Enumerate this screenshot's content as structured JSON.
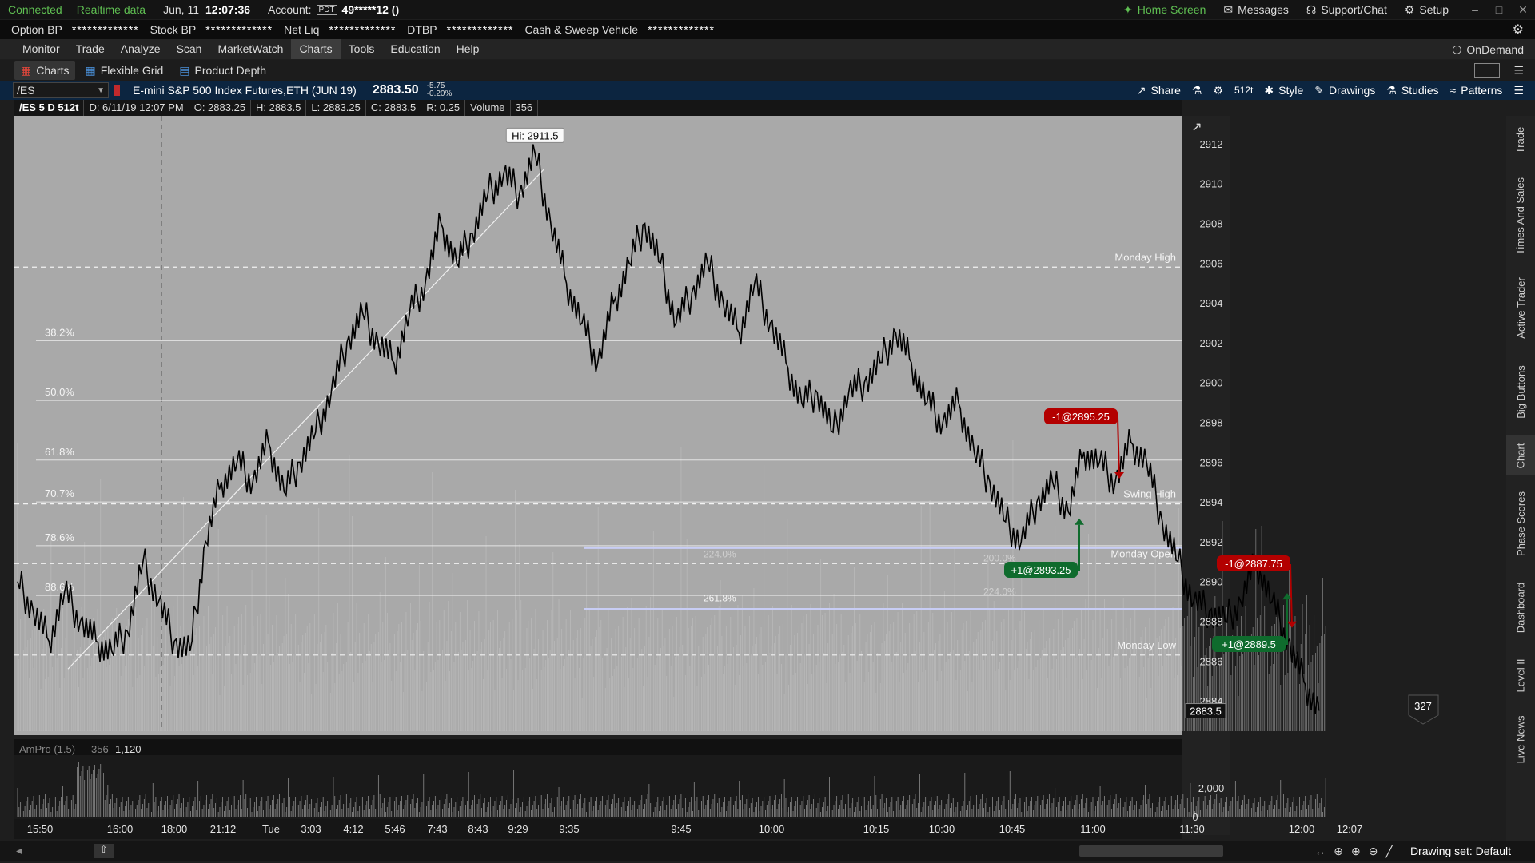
{
  "status": {
    "connection": "Connected",
    "data_mode": "Realtime data",
    "date": "Jun, 11",
    "time": "12:07:36",
    "account_label": "Account:",
    "account_badge": "PDT",
    "account_value": "49*****12 ()",
    "nav": [
      {
        "label": "Home Screen",
        "icon": "home-screen-icon"
      },
      {
        "label": "Messages",
        "icon": "envelope-icon"
      },
      {
        "label": "Support/Chat",
        "icon": "headset-icon"
      },
      {
        "label": "Setup",
        "icon": "gear-icon"
      }
    ]
  },
  "balances": [
    {
      "label": "Option BP",
      "value": "*************"
    },
    {
      "label": "Stock BP",
      "value": "*************"
    },
    {
      "label": "Net Liq",
      "value": "*************"
    },
    {
      "label": "DTBP",
      "value": "*************"
    },
    {
      "label": "Cash & Sweep Vehicle",
      "value": "*************"
    }
  ],
  "menu": [
    "Monitor",
    "Trade",
    "Analyze",
    "Scan",
    "MarketWatch",
    "Charts",
    "Tools",
    "Education",
    "Help"
  ],
  "menu_active": "Charts",
  "on_demand": "OnDemand",
  "subtabs": [
    "Charts",
    "Flexible Grid",
    "Product Depth"
  ],
  "symbol": {
    "ticker": "/ES",
    "description": "E-mini S&P 500 Index Futures,ETH (JUN 19)",
    "price": "2883.50",
    "change": "-5.75",
    "change_pct": "-0.20%"
  },
  "toolbar": [
    "Share",
    "512t",
    "Style",
    "Drawings",
    "Studies",
    "Patterns"
  ],
  "info": {
    "label": "/ES 5 D 512t",
    "date": "D: 6/11/19 12:07 PM",
    "open": "O: 2883.25",
    "high": "H: 2883.5",
    "low": "L: 2883.25",
    "close": "C: 2883.5",
    "range": "R: 0.25",
    "volume_label": "Volume",
    "volume": "356"
  },
  "chart_data": {
    "type": "line",
    "hi_label": "Hi: 2911.5",
    "y_ticks": [
      2912,
      2910,
      2908,
      2906,
      2904,
      2902,
      2900,
      2898,
      2896,
      2894,
      2892,
      2890,
      2888,
      2886,
      2884
    ],
    "ylim": [
      2883,
      2913
    ],
    "x_ticks": [
      "15:50",
      "16:00",
      "18:00",
      "21:12",
      "Tue",
      "3:03",
      "4:12",
      "5:46",
      "7:43",
      "8:43",
      "9:29",
      "9:35",
      "9:45",
      "10:00",
      "10:15",
      "10:30",
      "10:45",
      "11:00",
      "11:30",
      "12:00",
      "12:07"
    ],
    "price_path": [
      [
        0,
        2890
      ],
      [
        8,
        2888.5
      ],
      [
        16,
        2887
      ],
      [
        24,
        2889.5
      ],
      [
        32,
        2888
      ],
      [
        40,
        2887
      ],
      [
        48,
        2886.5
      ],
      [
        56,
        2887.5
      ],
      [
        64,
        2891
      ],
      [
        72,
        2889
      ],
      [
        80,
        2887
      ],
      [
        88,
        2886.5
      ],
      [
        96,
        2892
      ],
      [
        104,
        2895
      ],
      [
        112,
        2896
      ],
      [
        120,
        2895
      ],
      [
        128,
        2897
      ],
      [
        136,
        2894.5
      ],
      [
        144,
        2896
      ],
      [
        152,
        2897.5
      ],
      [
        160,
        2899.5
      ],
      [
        168,
        2902
      ],
      [
        176,
        2903.5
      ],
      [
        184,
        2902
      ],
      [
        192,
        2901
      ],
      [
        200,
        2903.5
      ],
      [
        208,
        2905
      ],
      [
        216,
        2908
      ],
      [
        224,
        2906
      ],
      [
        232,
        2907.5
      ],
      [
        240,
        2909.5
      ],
      [
        248,
        2910.5
      ],
      [
        256,
        2909.5
      ],
      [
        264,
        2911.5
      ],
      [
        272,
        2908
      ],
      [
        280,
        2905
      ],
      [
        288,
        2903
      ],
      [
        296,
        2901
      ],
      [
        304,
        2904
      ],
      [
        312,
        2906
      ],
      [
        320,
        2908
      ],
      [
        328,
        2906
      ],
      [
        336,
        2903
      ],
      [
        344,
        2904.5
      ],
      [
        352,
        2906
      ],
      [
        360,
        2904
      ],
      [
        368,
        2902.5
      ],
      [
        376,
        2905
      ],
      [
        384,
        2903
      ],
      [
        392,
        2901
      ],
      [
        400,
        2899
      ],
      [
        408,
        2899.5
      ],
      [
        416,
        2897.5
      ],
      [
        424,
        2899.5
      ],
      [
        432,
        2900
      ],
      [
        440,
        2901
      ],
      [
        448,
        2902.5
      ],
      [
        456,
        2901
      ],
      [
        464,
        2899
      ],
      [
        472,
        2898
      ],
      [
        480,
        2899
      ],
      [
        488,
        2896.5
      ],
      [
        496,
        2895
      ],
      [
        504,
        2893
      ],
      [
        512,
        2892
      ],
      [
        520,
        2894
      ],
      [
        528,
        2895
      ],
      [
        536,
        2893.5
      ],
      [
        544,
        2896.5
      ],
      [
        552,
        2896
      ],
      [
        560,
        2895
      ],
      [
        568,
        2897
      ],
      [
        576,
        2896
      ],
      [
        584,
        2893
      ],
      [
        592,
        2891
      ],
      [
        600,
        2889
      ],
      [
        608,
        2888.5
      ],
      [
        616,
        2888
      ],
      [
        624,
        2889
      ],
      [
        632,
        2891
      ],
      [
        640,
        2889
      ],
      [
        648,
        2887
      ],
      [
        656,
        2885
      ],
      [
        664,
        2883.5
      ]
    ],
    "fib_levels": [
      {
        "label": "38.2%",
        "value": 2902.1
      },
      {
        "label": "50.0%",
        "value": 2899.1
      },
      {
        "label": "61.8%",
        "value": 2896.1
      },
      {
        "label": "70.7%",
        "value": 2894.0
      },
      {
        "label": "78.6%",
        "value": 2891.8
      },
      {
        "label": "88.6%",
        "value": 2889.3
      }
    ],
    "extensions": [
      {
        "label": "224.0%",
        "value": 2891.7
      },
      {
        "label": "261.8%",
        "value": 2888.6
      },
      {
        "label": "200.0%",
        "value": 2891.1
      },
      {
        "label": "224.0%",
        "value": 2889.4
      }
    ],
    "reference_lines": [
      {
        "label": "Monday High",
        "value": 2905.8
      },
      {
        "label": "Swing High",
        "value": 2893.9
      },
      {
        "label": "Monday Open",
        "value": 2890.9
      },
      {
        "label": "Monday Low",
        "value": 2886.3
      }
    ],
    "trades": [
      {
        "label": "-1@2895.25",
        "side": "sell",
        "value": 2895.25
      },
      {
        "label": "+1@2893.25",
        "side": "buy",
        "value": 2893.25
      },
      {
        "label": "-1@2887.75",
        "side": "sell",
        "value": 2887.75
      },
      {
        "label": "+1@2889.5",
        "side": "buy",
        "value": 2889.5
      }
    ],
    "last_price": "2883.5",
    "bubble_count": "327",
    "volume_study": {
      "title": "AmPro (1.5)",
      "value1": "356",
      "value2": "1,120",
      "axis_ticks": [
        "2,000",
        "0"
      ]
    },
    "colors": {
      "background": "#a9a9a9",
      "price": "#000000",
      "sell": "#b30000",
      "buy": "#0f6b2d",
      "extension_line": "#c8cdf5"
    }
  },
  "right_tabs": [
    "Trade",
    "Times And Sales",
    "Active Trader",
    "Big Buttons",
    "Chart",
    "Phase Scores",
    "Dashboard",
    "Level II",
    "Live News"
  ],
  "drawing_set": "Drawing set: Default"
}
